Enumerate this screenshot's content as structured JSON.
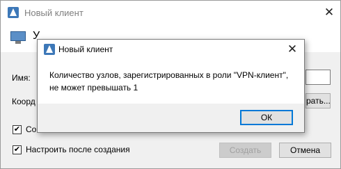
{
  "main_window": {
    "title": "Новый клиент",
    "banner_text": "У",
    "name_label": "Имя:",
    "name_value": "",
    "coords_label": "Коорд",
    "browse_button_label": "рать...",
    "checkbox1_label": "Со",
    "checkbox1_checked": true,
    "checkbox2_label": "Настроить после создания",
    "checkbox2_checked": true,
    "create_button_label": "Создать",
    "cancel_button_label": "Отмена"
  },
  "dialog": {
    "title": "Новый клиент",
    "message": "Количество узлов, зарегистрированных в роли \"VPN-клиент\",\nне может превышать 1",
    "ok_button_label": "ОК"
  },
  "icons": {
    "app": "app-logo-icon",
    "close": "close-icon",
    "computer": "computer-icon"
  },
  "colors": {
    "accent": "#0078d7",
    "app_icon": "#3d78b8"
  }
}
